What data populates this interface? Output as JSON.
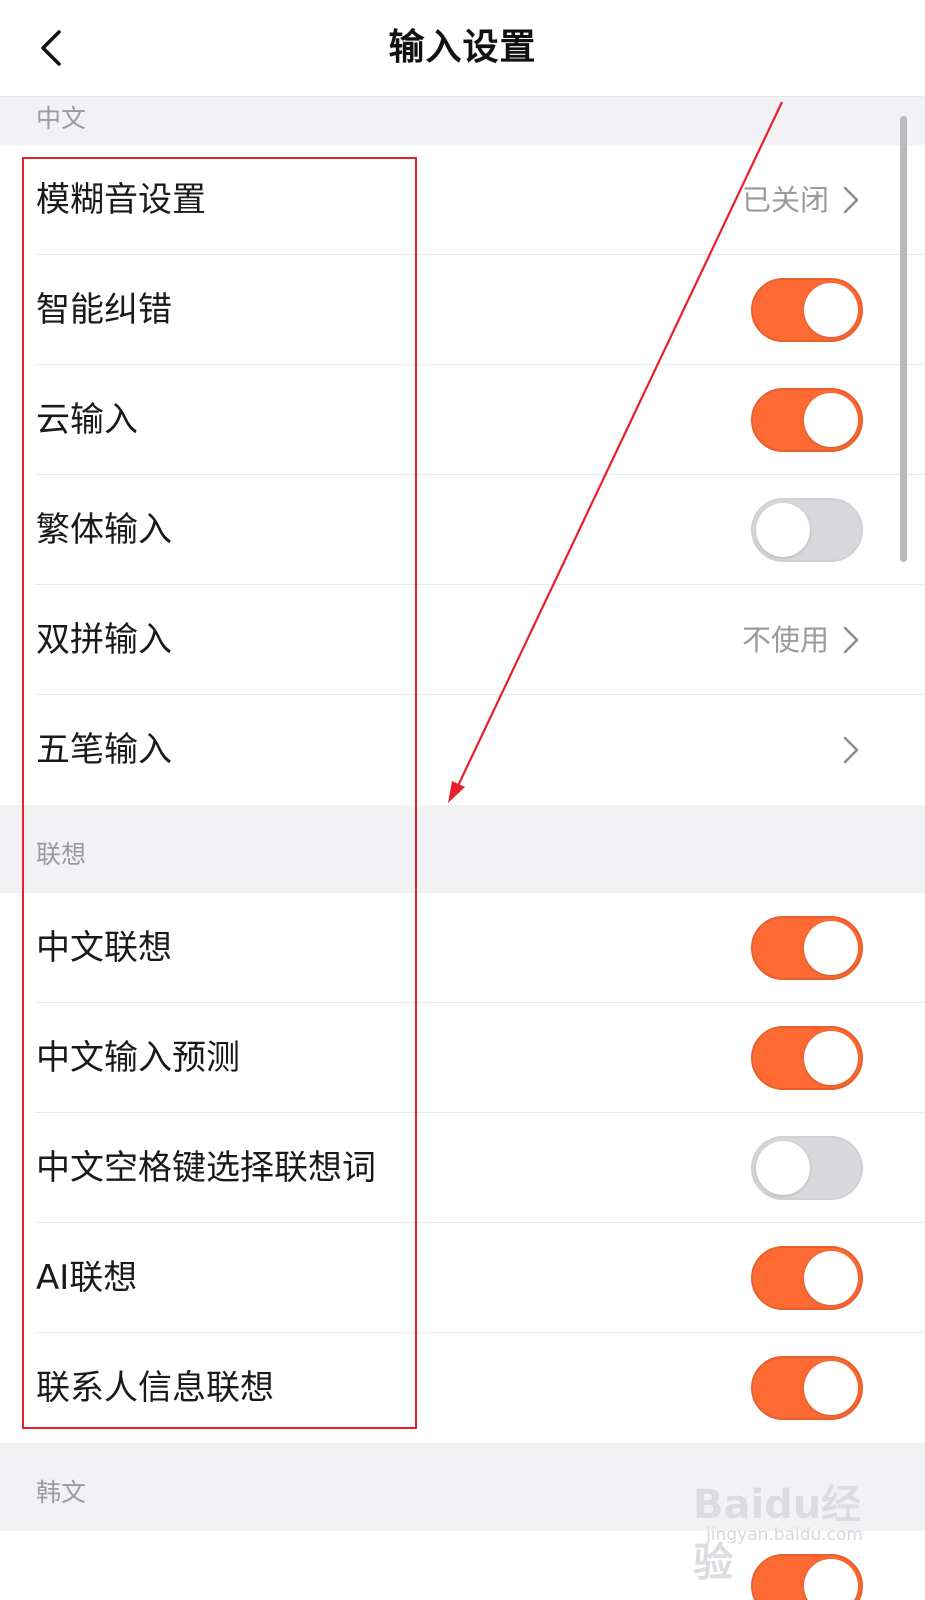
{
  "nav": {
    "title": "输入设置",
    "back_icon": "chevron-left-icon"
  },
  "sections": [
    {
      "header": "中文",
      "rows": [
        {
          "label": "模糊音设置",
          "type": "link",
          "value": "已关闭"
        },
        {
          "label": "智能纠错",
          "type": "toggle",
          "on": true
        },
        {
          "label": "云输入",
          "type": "toggle",
          "on": true
        },
        {
          "label": "繁体输入",
          "type": "toggle",
          "on": false
        },
        {
          "label": "双拼输入",
          "type": "link",
          "value": "不使用"
        },
        {
          "label": "五笔输入",
          "type": "link",
          "value": ""
        }
      ]
    },
    {
      "header": "联想",
      "rows": [
        {
          "label": "中文联想",
          "type": "toggle",
          "on": true
        },
        {
          "label": "中文输入预测",
          "type": "toggle",
          "on": true
        },
        {
          "label": "中文空格键选择联想词",
          "type": "toggle",
          "on": false
        },
        {
          "label": "AI联想",
          "type": "toggle",
          "on": true
        },
        {
          "label": "联系人信息联想",
          "type": "toggle",
          "on": true
        }
      ]
    },
    {
      "header": "韩文",
      "rows": [
        {
          "label": "",
          "type": "toggle",
          "on": true
        }
      ]
    }
  ],
  "watermark": {
    "logo_text": "Baidu经验",
    "url_text": "jingyan.baidu.com"
  },
  "colors": {
    "accent": "#ff6a34",
    "annotation": "#e8202a",
    "background": "#f2f2f5"
  }
}
